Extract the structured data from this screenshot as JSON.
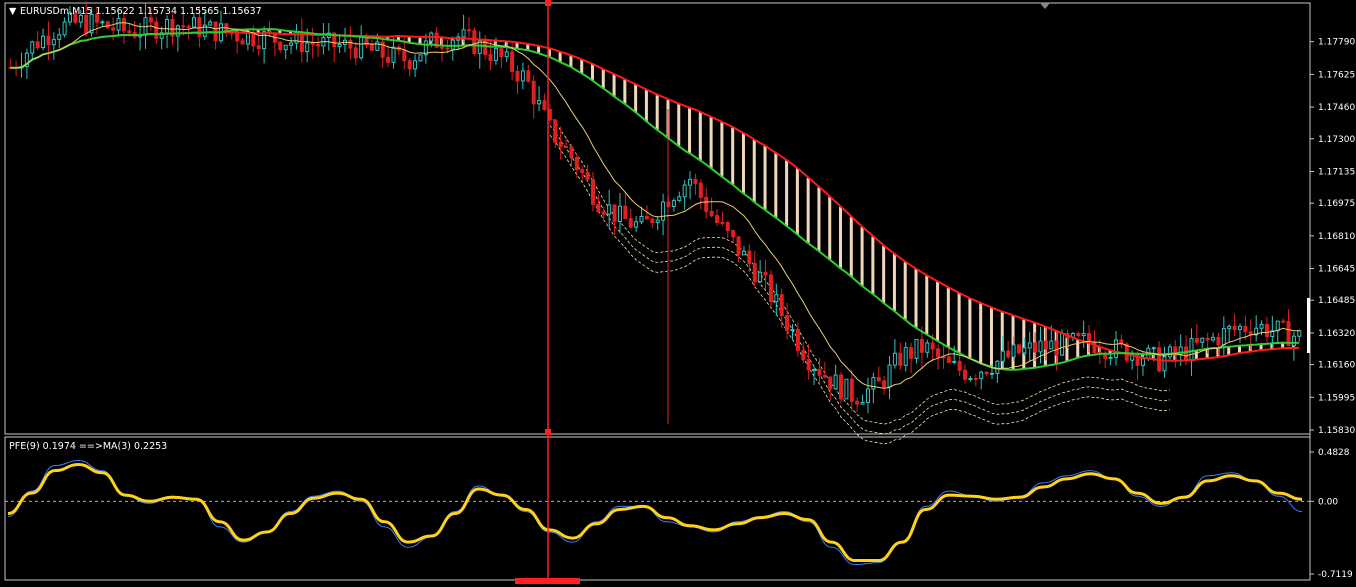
{
  "header": {
    "main_title": "EURUSDm,M15  1.15622 1.15734 1.15565 1.15637",
    "sub_title": "PFE(9) 0.1974  ==>MA(3) 0.2253"
  },
  "colors": {
    "background": "#000000",
    "frame": "#c8c8c8",
    "bull_candle": "#33c3c3",
    "bear_candle": "#e02020",
    "red_ma": "#ff1a1a",
    "green_ma": "#2ecc2e",
    "cloud_fill": "#ffe4c4",
    "envelope": "#f2e6b0",
    "vertical_marker": "#ff2020",
    "pfe_line": "#3b7bff",
    "pfe_ma": "#ffd21a"
  },
  "main_axis": {
    "ticks": [
      "1.17790",
      "1.17625",
      "1.17460",
      "1.17300",
      "1.17135",
      "1.16975",
      "1.16810",
      "1.16645",
      "1.16485",
      "1.16320",
      "1.16160",
      "1.15995",
      "1.15830"
    ]
  },
  "sub_axis": {
    "ticks": [
      "0.4828",
      "0.00",
      "-0.7119"
    ]
  },
  "chart_data": [
    {
      "type": "line",
      "title": "EURUSDm,M15  1.15622 1.15734 1.15565 1.15637",
      "ylim": [
        1.1583,
        1.1795
      ],
      "series_description": [
        {
          "values_close": [
            1.1766,
            1.1778,
            1.1786,
            1.1789,
            1.1787,
            1.1784,
            1.1786,
            1.1788,
            1.1786,
            1.1784,
            1.1782,
            1.1781,
            1.1779,
            1.1778,
            1.1777,
            1.1776,
            1.1772,
            1.177,
            1.1779,
            1.1782,
            1.1777,
            1.177,
            1.176,
            1.1735,
            1.172,
            1.17,
            1.169,
            1.1685,
            1.17,
            1.171,
            1.169,
            1.1675,
            1.166,
            1.164,
            1.162,
            1.1608,
            1.16,
            1.1605,
            1.162,
            1.1625,
            1.1615,
            1.1612,
            1.1617,
            1.1622,
            1.1625,
            1.1626,
            1.1628,
            1.1624,
            1.1622,
            1.1618,
            1.1622,
            1.1627,
            1.1633,
            1.1636,
            1.1633,
            1.163
          ]
        }
      ],
      "vertical_marker_index": 22
    },
    {
      "type": "line",
      "title": "PFE(9) 0.1974  ==>MA(3) 0.2253",
      "ylim": [
        -0.7119,
        0.4828
      ],
      "series": [
        {
          "name": "PFE(9)",
          "values": [
            -0.15,
            0.1,
            0.35,
            0.4,
            0.3,
            0.05,
            -0.02,
            0.05,
            0.02,
            -0.25,
            -0.4,
            -0.3,
            -0.1,
            0.05,
            0.1,
            0.0,
            -0.25,
            -0.45,
            -0.35,
            -0.1,
            0.15,
            0.05,
            -0.1,
            -0.3,
            -0.4,
            -0.2,
            -0.05,
            -0.05,
            -0.2,
            -0.25,
            -0.3,
            -0.2,
            -0.15,
            -0.1,
            -0.2,
            -0.45,
            -0.62,
            -0.6,
            -0.4,
            -0.05,
            0.1,
            0.05,
            0.0,
            0.05,
            0.18,
            0.25,
            0.3,
            0.22,
            0.05,
            -0.05,
            0.05,
            0.25,
            0.28,
            0.2,
            0.05,
            -0.1
          ]
        },
        {
          "name": "MA(3)",
          "values": [
            -0.12,
            0.08,
            0.3,
            0.36,
            0.28,
            0.06,
            0.0,
            0.04,
            0.02,
            -0.2,
            -0.38,
            -0.3,
            -0.12,
            0.03,
            0.08,
            0.02,
            -0.2,
            -0.4,
            -0.34,
            -0.12,
            0.12,
            0.06,
            -0.08,
            -0.28,
            -0.36,
            -0.22,
            -0.08,
            -0.05,
            -0.16,
            -0.24,
            -0.28,
            -0.22,
            -0.16,
            -0.12,
            -0.18,
            -0.4,
            -0.58,
            -0.58,
            -0.4,
            -0.08,
            0.06,
            0.05,
            0.02,
            0.04,
            0.14,
            0.22,
            0.27,
            0.22,
            0.08,
            -0.02,
            0.04,
            0.2,
            0.25,
            0.2,
            0.08,
            0.02
          ]
        }
      ]
    }
  ]
}
